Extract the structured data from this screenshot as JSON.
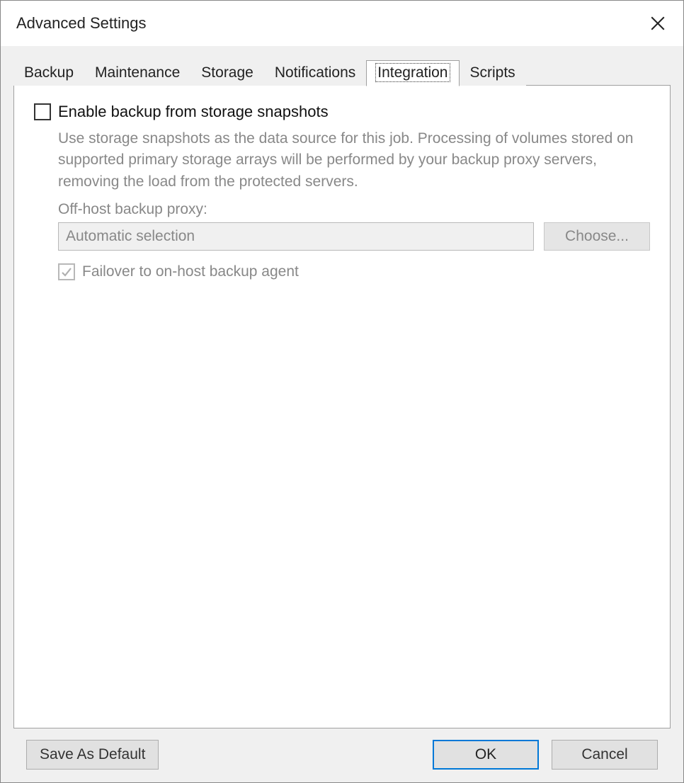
{
  "dialog": {
    "title": "Advanced Settings"
  },
  "tabs": {
    "backup": "Backup",
    "maintenance": "Maintenance",
    "storage": "Storage",
    "notifications": "Notifications",
    "integration": "Integration",
    "scripts": "Scripts",
    "active": "integration"
  },
  "integration": {
    "enable_label": "Enable backup from storage snapshots",
    "enable_checked": false,
    "description": "Use storage snapshots as the data source for this job. Processing of volumes stored on supported primary storage arrays will be performed by your backup proxy servers, removing the load from the protected servers.",
    "proxy_label": "Off-host backup proxy:",
    "proxy_value": "Automatic selection",
    "choose_label": "Choose...",
    "failover_label": "Failover to on-host backup agent",
    "failover_checked": true
  },
  "footer": {
    "save_default": "Save As Default",
    "ok": "OK",
    "cancel": "Cancel"
  }
}
